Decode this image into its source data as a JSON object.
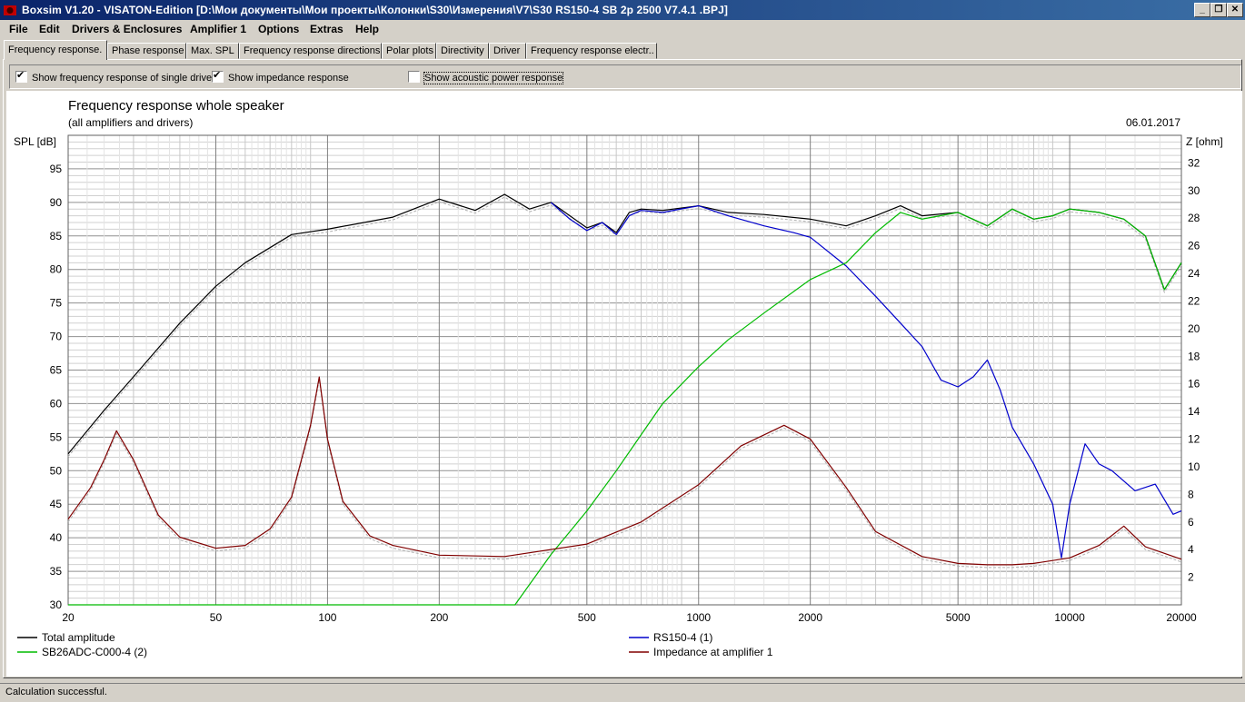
{
  "window": {
    "title": "Boxsim V1.20 - VISATON-Edition [D:\\Мои документы\\Мои проекты\\Колонки\\S30\\Измерения\\V7\\S30 RS150-4 SB 2p 2500  V7.4.1 .BPJ]",
    "minimize": "_",
    "restore": "❐",
    "close": "✕"
  },
  "menu": [
    "File",
    "Edit",
    "Drivers & Enclosures",
    "Amplifier 1",
    "Options",
    "Extras",
    "Help"
  ],
  "tabs": [
    {
      "label": "Frequency response.",
      "active": true
    },
    {
      "label": "Phase response"
    },
    {
      "label": "Max. SPL"
    },
    {
      "label": "Frequency response directions"
    },
    {
      "label": "Polar plots"
    },
    {
      "label": "Directivity"
    },
    {
      "label": "Driver"
    },
    {
      "label": "Frequency response electr.."
    }
  ],
  "options": {
    "single_drive": {
      "label": "Show frequency response of single drive",
      "checked": true
    },
    "impedance": {
      "label": "Show impedance response",
      "checked": true
    },
    "acoustic_power": {
      "label": "Show acoustic power response",
      "checked": false
    }
  },
  "status": "Calculation successful.",
  "chart_data": {
    "type": "line",
    "title": "Frequency response whole speaker",
    "subtitle": "(all amplifiers and drivers)",
    "date": "06.01.2017",
    "ylabel": "SPL [dB]",
    "y2label": "Z [ohm]",
    "xscale": "log",
    "xlim": [
      20,
      20000
    ],
    "ylim": [
      30,
      100
    ],
    "y2lim": [
      0,
      34
    ],
    "xticks": [
      "20",
      "50",
      "100",
      "200",
      "500",
      "1000",
      "2000",
      "5000",
      "10000",
      "20000"
    ],
    "yticks": [
      "30",
      "35",
      "40",
      "45",
      "50",
      "55",
      "60",
      "65",
      "70",
      "75",
      "80",
      "85",
      "90",
      "95"
    ],
    "y2ticks": [
      "2",
      "4",
      "6",
      "8",
      "10",
      "12",
      "14",
      "16",
      "18",
      "20",
      "22",
      "24",
      "26",
      "28",
      "30",
      "32"
    ],
    "grid": true,
    "colors": {
      "total": "#000000",
      "woofer": "#0000cc",
      "tweeter": "#00bb00",
      "impedance": "#800000",
      "reference": "#b0b0b0"
    },
    "series": [
      {
        "name": "Total amplitude",
        "color": "#000000",
        "axis": "left",
        "x": [
          20,
          25,
          30,
          40,
          50,
          60,
          80,
          100,
          150,
          200,
          250,
          300,
          350,
          400,
          450,
          500,
          550,
          600,
          650,
          700,
          800,
          1000,
          1200,
          1500,
          2000,
          2500,
          3000,
          3500,
          4000,
          5000,
          6000,
          7000,
          8000,
          9000,
          10000,
          12000,
          14000,
          16000,
          18000,
          20000
        ],
        "y": [
          52.5,
          59,
          64,
          72,
          77.5,
          81,
          85.2,
          86,
          87.8,
          90.5,
          88.8,
          91.2,
          89,
          90,
          88,
          86.2,
          87,
          85.5,
          88.5,
          89,
          88.8,
          89.5,
          88.5,
          88.2,
          87.5,
          86.5,
          88,
          89.5,
          88,
          88.5,
          86.5,
          89,
          87.5,
          88,
          89,
          88.5,
          87.5,
          85,
          77,
          81
        ]
      },
      {
        "name": "RS150-4 (1)",
        "color": "#0000cc",
        "axis": "left",
        "x": [
          400,
          450,
          500,
          550,
          600,
          650,
          700,
          800,
          1000,
          1200,
          1500,
          1800,
          2000,
          2500,
          3000,
          3500,
          4000,
          4500,
          5000,
          5500,
          6000,
          6500,
          7000,
          8000,
          9000,
          9500,
          10000,
          11000,
          12000,
          13000,
          15000,
          17000,
          19000,
          20000
        ],
        "y": [
          90,
          87.5,
          85.8,
          87,
          85.2,
          88,
          88.8,
          88.5,
          89.5,
          88,
          86.5,
          85.5,
          84.8,
          80.5,
          76,
          72,
          68.5,
          63.5,
          62.5,
          64,
          66.5,
          62,
          56.5,
          51,
          45,
          37,
          45,
          54,
          51,
          50,
          47,
          48,
          43.5,
          44
        ]
      },
      {
        "name": "SB26ADC-C000-4 (2)",
        "color": "#00bb00",
        "axis": "left",
        "x": [
          20,
          320,
          400,
          500,
          600,
          800,
          1000,
          1200,
          1500,
          2000,
          2500,
          3000,
          3500,
          4000,
          5000,
          6000,
          7000,
          8000,
          9000,
          10000,
          12000,
          14000,
          16000,
          18000,
          20000
        ],
        "y": [
          30,
          30,
          37.5,
          44,
          50,
          60,
          65.5,
          69.5,
          73.5,
          78.5,
          81,
          85.5,
          88.5,
          87.5,
          88.5,
          86.5,
          89,
          87.5,
          88,
          89,
          88.5,
          87.5,
          85,
          77,
          81
        ]
      },
      {
        "name": "Impedance at amplifier 1",
        "color": "#800000",
        "axis": "right",
        "x": [
          20,
          23,
          25,
          27,
          30,
          35,
          40,
          50,
          60,
          70,
          80,
          90,
          95,
          100,
          110,
          130,
          150,
          200,
          300,
          500,
          700,
          1000,
          1300,
          1700,
          2000,
          2500,
          3000,
          4000,
          5000,
          6000,
          7000,
          8000,
          10000,
          12000,
          14000,
          16000,
          20000
        ],
        "y": [
          6.2,
          8.5,
          10.5,
          12.6,
          10.5,
          6.5,
          4.9,
          4.1,
          4.3,
          5.5,
          7.8,
          13,
          16.5,
          12,
          7.5,
          5,
          4.3,
          3.6,
          3.5,
          4.4,
          6,
          8.7,
          11.5,
          13,
          12,
          8.5,
          5.3,
          3.5,
          3,
          2.9,
          2.9,
          3,
          3.4,
          4.3,
          5.7,
          4.2,
          3.3
        ]
      }
    ],
    "legend": [
      "Total amplitude",
      "RS150-4 (1)",
      "SB26ADC-C000-4 (2)",
      "Impedance at amplifier 1"
    ],
    "legend_placement": "bottom"
  }
}
